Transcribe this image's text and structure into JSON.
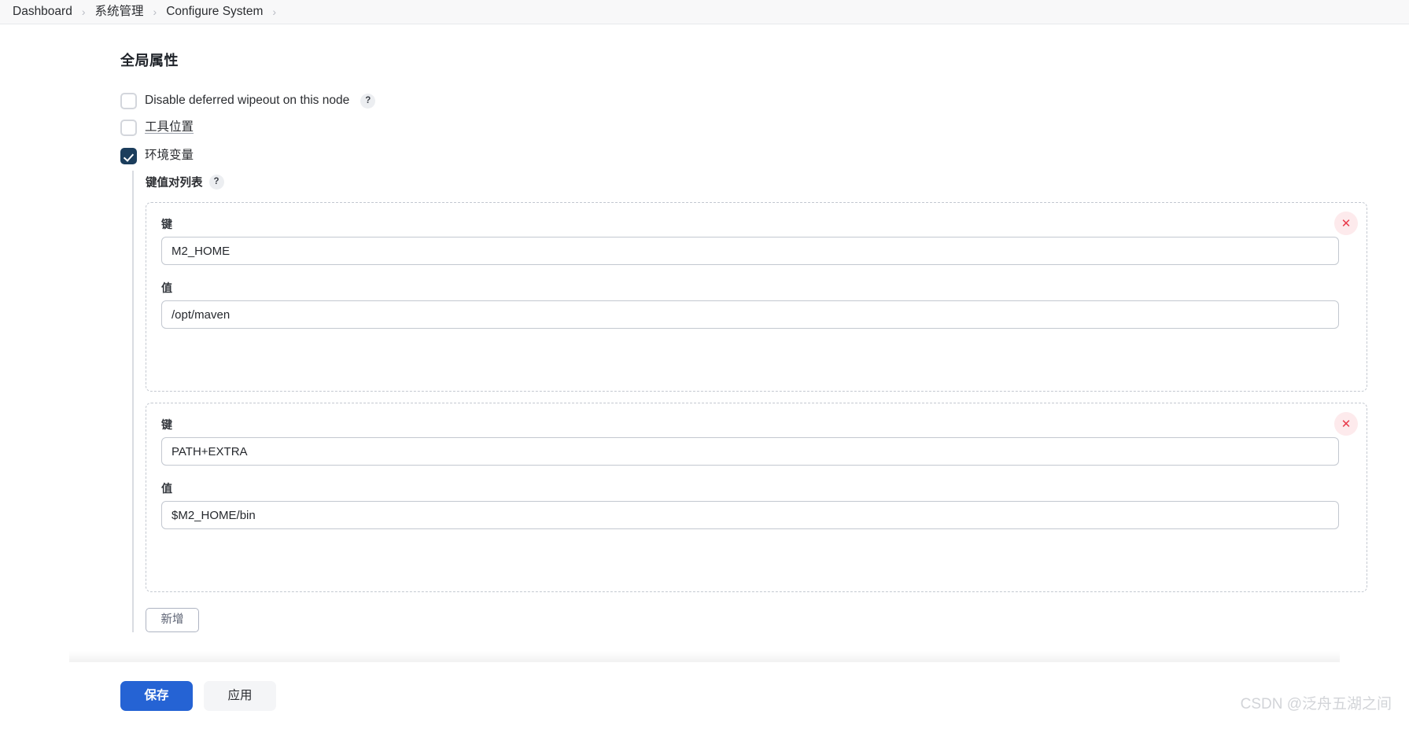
{
  "breadcrumb": {
    "separator": "›",
    "items": [
      {
        "label": "Dashboard"
      },
      {
        "label": "系统管理"
      },
      {
        "label": "Configure System"
      }
    ]
  },
  "page": {
    "title": "全局属性"
  },
  "checkboxes": [
    {
      "label": "Disable deferred wipeout on this node",
      "checked": false,
      "underlined": false,
      "has_help": true,
      "help_glyph": "?"
    },
    {
      "label": "工具位置",
      "checked": false,
      "underlined": true,
      "has_help": false,
      "help_glyph": ""
    },
    {
      "label": "环境变量",
      "checked": true,
      "underlined": false,
      "has_help": false,
      "help_glyph": ""
    }
  ],
  "env_section": {
    "list_label": "键值对列表",
    "list_help_glyph": "?",
    "key_label": "键",
    "value_label": "值",
    "delete_glyph": "✕",
    "add_label": "新增",
    "entries": [
      {
        "key": "M2_HOME",
        "value": "/opt/maven"
      },
      {
        "key": "PATH+EXTRA",
        "value": "$M2_HOME/bin"
      }
    ]
  },
  "footer": {
    "save_label": "保存",
    "apply_label": "应用"
  },
  "watermark": {
    "text": "CSDN @泛舟五湖之间"
  },
  "colors": {
    "primary": "#2563d4",
    "checkbox_checked": "#1b3d5c",
    "danger": "#e8394a",
    "dashed_border": "#c3c8d0"
  }
}
